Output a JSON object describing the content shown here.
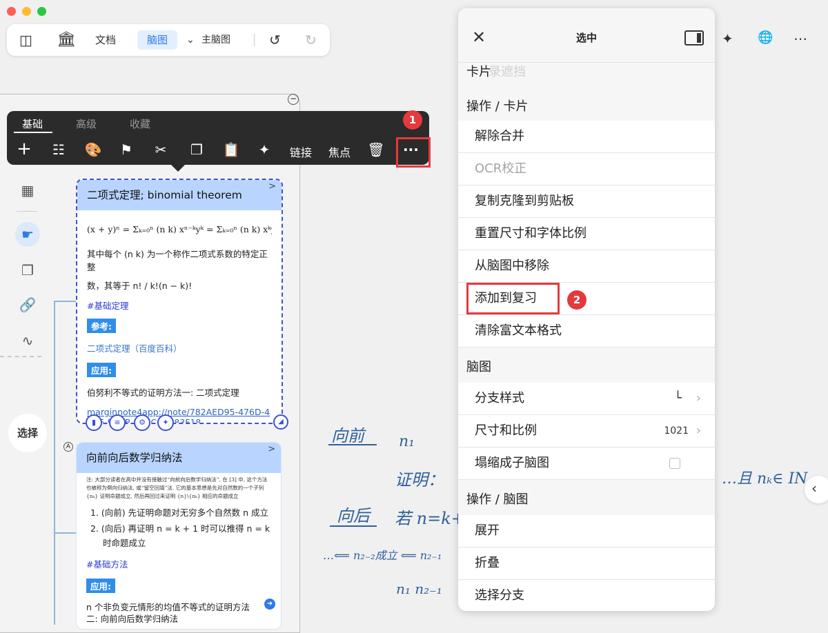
{
  "window": {
    "dot_colors": [
      "#fe5f57",
      "#febc2e",
      "#28c840"
    ]
  },
  "toolbar": {
    "docs": "文档",
    "mindmap": "脑图",
    "main_map": "主脑图"
  },
  "float_menu": {
    "tabs": [
      "基础",
      "高级",
      "收藏"
    ],
    "link": "链接",
    "focus": "焦点",
    "more": "···"
  },
  "badges": {
    "first": "1",
    "second": "2"
  },
  "select_button": "选择",
  "card1": {
    "title": "二项式定理; binomial theorem",
    "formula": "(x + y)ⁿ = Σₖ₌₀ⁿ (n k) xⁿ⁻ᵏyᵏ = Σₖ₌₀ⁿ (n k) xᵏyⁿ⁻ᵏ",
    "desc1": "其中每个 (n k) 为一个称作二项式系数的特定正整",
    "desc2": "数，其等于 n! / k!(n − k)!",
    "tag": "#基础定理",
    "ref_label": "参考:",
    "ref_link": "二项式定理（百度百科）",
    "app_label": "应用:",
    "app_text": "伯努利不等式的证明方法一: 二项式定理",
    "url": "marginnote4app://note/782AED95-476D-4D95-BB4B-2C6CC7A83F18"
  },
  "card2": {
    "title": "向前向后数学归纳法",
    "note": "注: 大部分读者在高中并没有接触过“向前向后数学归纳法”, 在 [3] 中, 这个方法也被称为倒向归纳法, 或“留空回填”法. 它的基本思想是先对自然数的一个子列 {nₖ} 证明命题成立, 然后再回过来证明 {n}\\{nₖ} 相应的命题成立",
    "step1": "1.  (向前) 先证明命题对无穷多个自然数 n 成立",
    "step2a": "2.  (向后) 再证明 n = k + 1 时可以推得 n = k",
    "step2b": "时命题成立",
    "tag": "#基础方法",
    "app_label": "应用:",
    "app_text": "n 个非负变元情形的均值不等式的证明方法二: 向前向后数学归纳法"
  },
  "canvas": {
    "forward": "向前",
    "backward": "向后",
    "proof": "证明：",
    "if": "若 n=k+",
    "and": "…且 nₖ∈ IN",
    "n1": "n₁",
    "n2": "n₁ n₂₋₁",
    "chain": "…⟸ n₂₋₂成立 ⟸ n₂₋₁",
    "ghost": "录遮挡"
  },
  "panel": {
    "title": "选中",
    "sections": {
      "card": "卡片",
      "ops_card": "操作 / 卡片",
      "mindmap": "脑图",
      "ops_mindmap": "操作 / 脑图"
    },
    "items": [
      {
        "label": "解除合并"
      },
      {
        "label": "OCR校正"
      },
      {
        "label": "复制克隆到剪贴板"
      },
      {
        "label": "重置尺寸和字体比例"
      },
      {
        "label": "从脑图中移除"
      },
      {
        "label": "添加到复习"
      },
      {
        "label": "清除富文本格式"
      }
    ],
    "branch_style": "分支样式",
    "size_ratio": "尺寸和比例",
    "size_value": "1021",
    "collapse_sub": "塌缩成子脑图",
    "expand": "展开",
    "fold": "折叠",
    "select_branch": "选择分支"
  }
}
